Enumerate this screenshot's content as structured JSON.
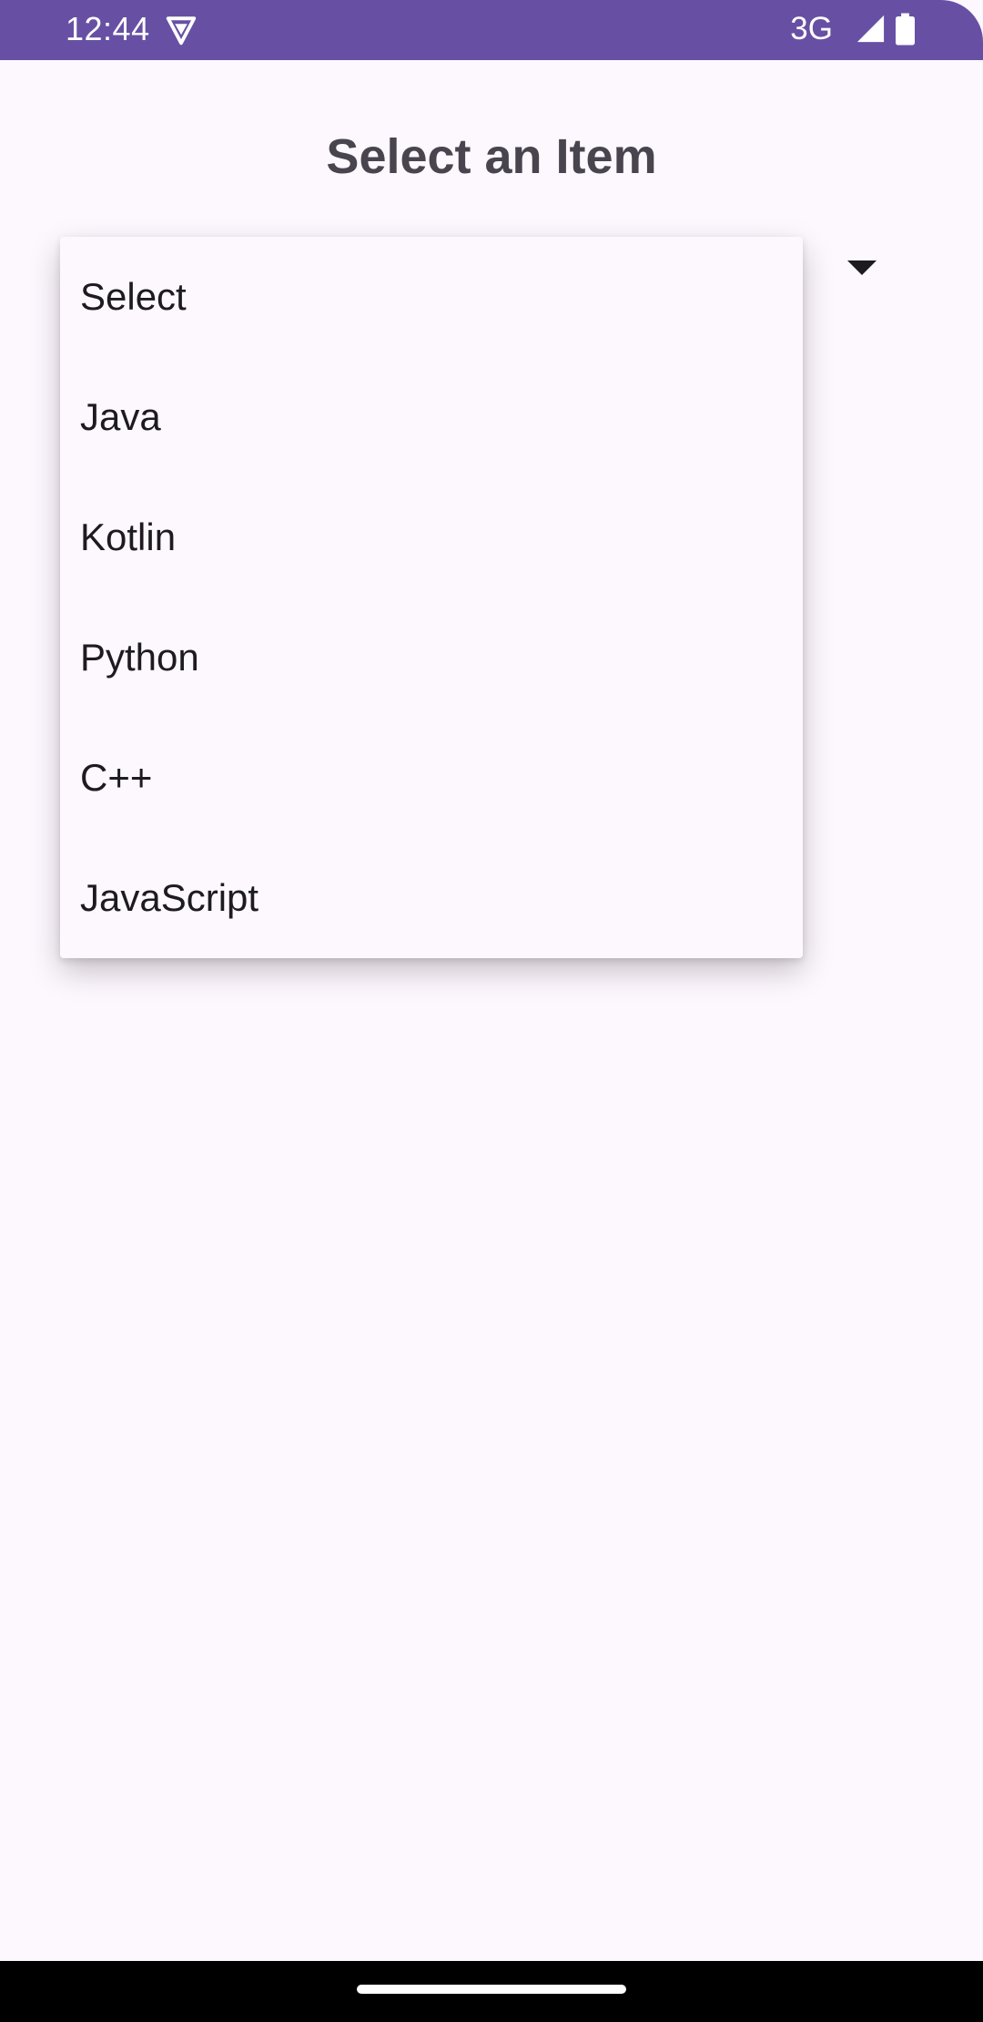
{
  "status_bar": {
    "time": "12:44",
    "network": "3G",
    "icons": [
      "vpn-shield-icon",
      "signal-icon",
      "battery-icon"
    ],
    "background": "#6750a4"
  },
  "title": "Select an Item",
  "spinner": {
    "selected_value": "Select",
    "arrow_icon": "dropdown-arrow-icon",
    "options": [
      "Select",
      "Java",
      "Kotlin",
      "Python",
      "C++",
      "JavaScript"
    ]
  },
  "colors": {
    "background": "#fdf7fe",
    "title_text": "#49454f",
    "item_text": "#1d1b20",
    "status_bar": "#6750a4",
    "nav_bar": "#000000"
  }
}
